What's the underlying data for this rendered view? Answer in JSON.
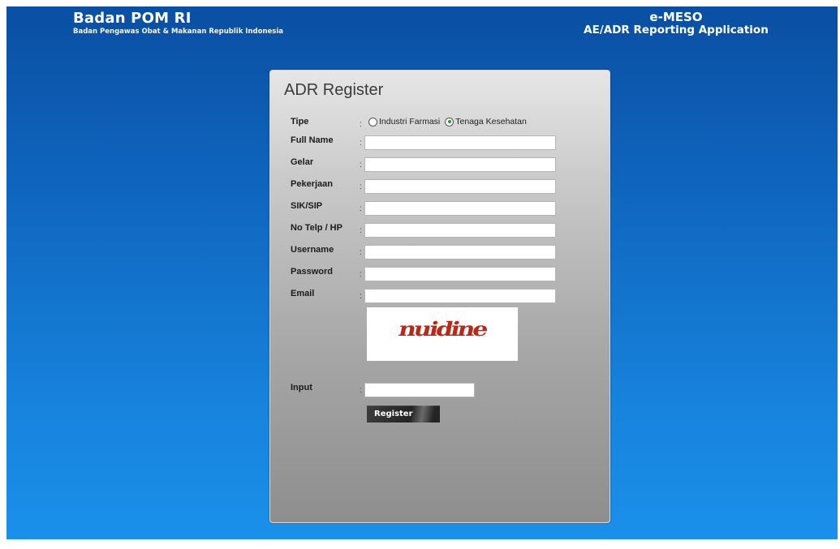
{
  "header": {
    "org_name": "Badan POM RI",
    "org_full_name": "Badan Pengawas Obat & Makanan Republik Indonesia",
    "app_name": "e-MESO",
    "app_subtitle": "AE/ADR Reporting Application"
  },
  "form": {
    "title": "ADR Register",
    "colon": ":",
    "tipe": {
      "label": "Tipe",
      "options": [
        "Industri Farmasi",
        "Tenaga Kesehatan"
      ],
      "selected": "Tenaga Kesehatan"
    },
    "fields": {
      "full_name": {
        "label": "Full Name",
        "value": ""
      },
      "gelar": {
        "label": "Gelar",
        "value": ""
      },
      "pekerjaan": {
        "label": "Pekerjaan",
        "value": ""
      },
      "sik_sip": {
        "label": "SIK/SIP",
        "value": ""
      },
      "no_telp": {
        "label": "No Telp / HP",
        "value": ""
      },
      "username": {
        "label": "Username",
        "value": ""
      },
      "password": {
        "label": "Password",
        "value": ""
      },
      "email": {
        "label": "Email",
        "value": ""
      }
    },
    "captcha": {
      "text": "nuidine"
    },
    "input": {
      "label": "Input",
      "value": ""
    },
    "register_label": "Register"
  },
  "colors": {
    "background_top": "#0a4fa3",
    "background_bottom": "#1a90ea",
    "captcha_text": "#b8291a",
    "radio_checked": "#1e9c2e"
  }
}
